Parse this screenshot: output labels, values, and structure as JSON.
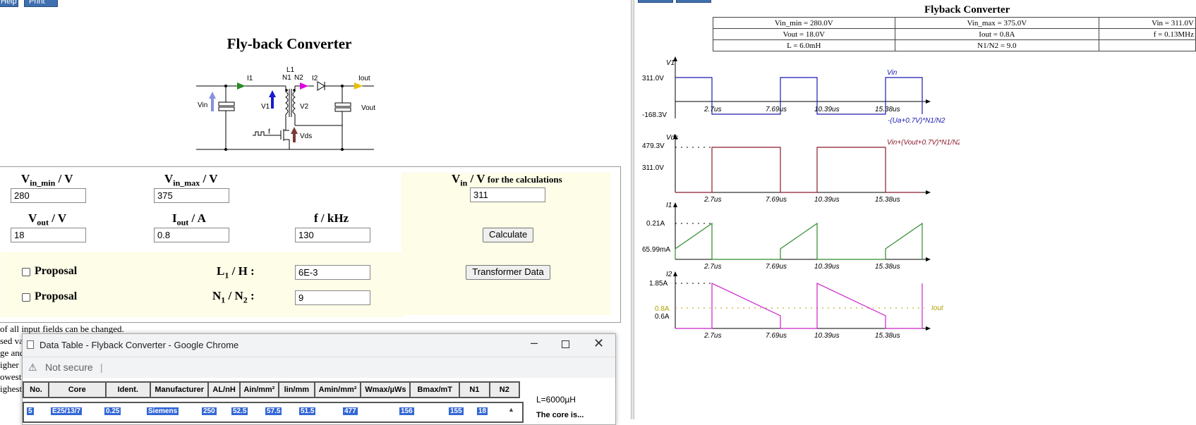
{
  "topbar": {
    "help_label": "Help",
    "print_label": "Print"
  },
  "page_title": "Fly-back Converter",
  "schematic": {
    "labels": {
      "L1": "L1",
      "N1": "N1",
      "N2": "N2",
      "I1": "I1",
      "I2": "I2",
      "Iout": "Iout",
      "Vin": "Vin",
      "V1": "V1",
      "V2": "V2",
      "Vout": "Vout",
      "f": "f",
      "Vds": "Vds"
    }
  },
  "form": {
    "vin_min": {
      "label_main": "V",
      "label_sub": "in_min",
      "label_unit": " / V",
      "value": "280"
    },
    "vin_max": {
      "label_main": "V",
      "label_sub": "in_max",
      "label_unit": " / V",
      "value": "375"
    },
    "vin_calc": {
      "label_main": "V",
      "label_sub": "in",
      "label_unit": " / V",
      "label_suffix": " for the calculations",
      "value": "311"
    },
    "vout": {
      "label_main": "V",
      "label_sub": "out",
      "label_unit": " / V",
      "value": "18"
    },
    "iout": {
      "label_main": "I",
      "label_sub": "out",
      "label_unit": " / A",
      "value": "0.8"
    },
    "freq": {
      "label": "f / kHz",
      "value": "130"
    },
    "calculate_label": "Calculate",
    "proposal1_label": "Proposal",
    "proposal2_label": "Proposal",
    "l1": {
      "label_main": "L",
      "label_sub": "1",
      "label_unit": " / H :",
      "value": "6E-3"
    },
    "n1n2": {
      "label_main": "N",
      "label_sub1": "1",
      "label_mid": " / N",
      "label_sub2": "2",
      "label_unit": " :",
      "value": "9"
    },
    "transformer_label": "Transformer Data"
  },
  "notes": [
    "of all input fields can be changed.",
    "sed va",
    "ge and",
    "igher",
    "owest",
    "ighest"
  ],
  "popup": {
    "title": "Data Table - Flyback Converter - Google Chrome",
    "address": "Not secure",
    "columns": [
      "No.",
      "Core",
      "Ident.",
      "Manufacturer",
      "AL/nH",
      "Ain/mm²",
      "lin/mm",
      "Amin/mm²",
      "Wmax/µWs",
      "Bmax/mT",
      "N1",
      "N2"
    ],
    "row": [
      "5",
      "E25/13/7",
      "0.25",
      "Siemens",
      "250",
      "52.5",
      "57.5",
      "51.5",
      "477",
      "156",
      "155",
      "18"
    ],
    "side_text1": "L=6000µH",
    "side_text2": "The core is..."
  },
  "right": {
    "title": "Flyback Converter",
    "params": [
      [
        "Vin_min = 280.0V",
        "Vin_max = 375.0V",
        "Vin = 311.0V"
      ],
      [
        "Vout = 18.0V",
        "Iout = 0.8A",
        "f = 0.13MHz"
      ],
      [
        "L = 6.0mH",
        "N1/N2 = 9.0",
        ""
      ]
    ],
    "ticks": [
      "2.7us",
      "7.69us",
      "10.39us",
      "15.38us"
    ],
    "plot1": {
      "name": "V1",
      "y_hi": "311.0V",
      "y_lo": "-168.3V",
      "label_top": "Vin",
      "label_bot": "-(Ua+0.7V)*N1/N2",
      "color": "#1b1bb0"
    },
    "plot2": {
      "name": "Vds",
      "y_hi": "479.3V",
      "y_mid": "311.0V",
      "label_top": "Vin+(Vout+0.7V)*N1/N2",
      "color": "#8b1a2b"
    },
    "plot3": {
      "name": "I1",
      "y_hi": "0.21A",
      "y_lo": "65.99mA",
      "color": "#2e8b2e"
    },
    "plot4": {
      "name": "I2",
      "y_hi": "1.85A",
      "y_mid": "0.8A",
      "y_lo": "0.6A",
      "label_iout": "Iout",
      "color": "#cc22cc"
    }
  }
}
